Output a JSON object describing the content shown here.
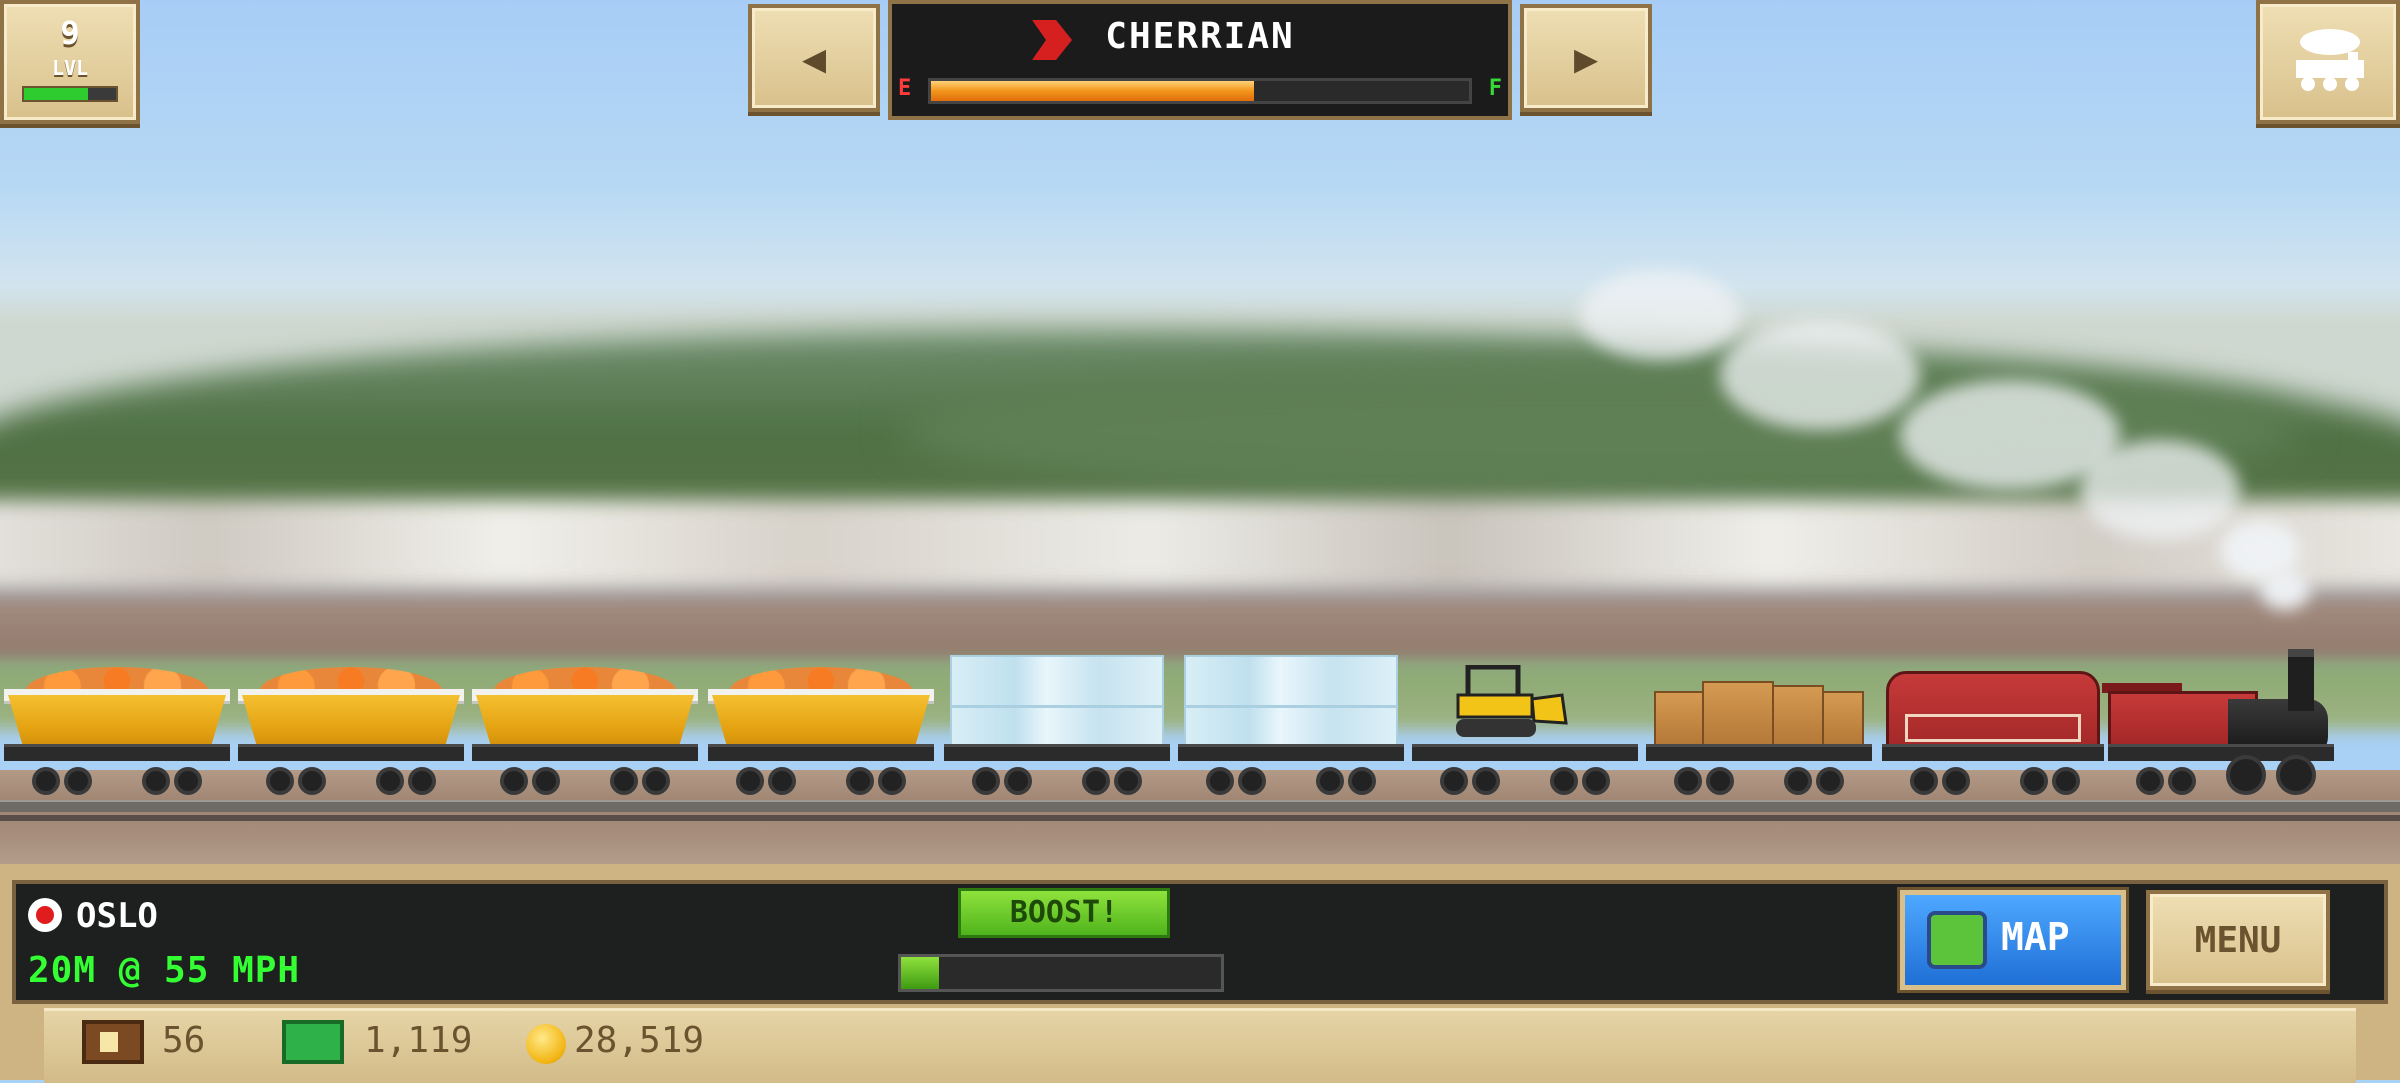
{
  "hud": {
    "level": {
      "number": "9",
      "label": "LVL",
      "progress": 0.7
    },
    "train": {
      "name": "CHERRIAN",
      "fuel_level": 0.6,
      "fuel_empty_label": "E",
      "fuel_full_label": "F",
      "prev_icon": "left-arrow-icon",
      "next_icon": "right-arrow-icon"
    },
    "trains_button_icon": "train-icon"
  },
  "status": {
    "station": "OSLO",
    "speed_readout": "20M @ 55 MPH",
    "boost_label": "BOOST!",
    "boost_level": 0.12
  },
  "buttons": {
    "map_label": "MAP",
    "menu_label": "MENU"
  },
  "resources": {
    "crates": "56",
    "cash": "1,119",
    "coins": "28,519"
  },
  "colors": {
    "fuel": "#f3961a",
    "speed_text": "#33ff33",
    "map_button": "#1f6fd6",
    "boost": "#4fb41c"
  }
}
